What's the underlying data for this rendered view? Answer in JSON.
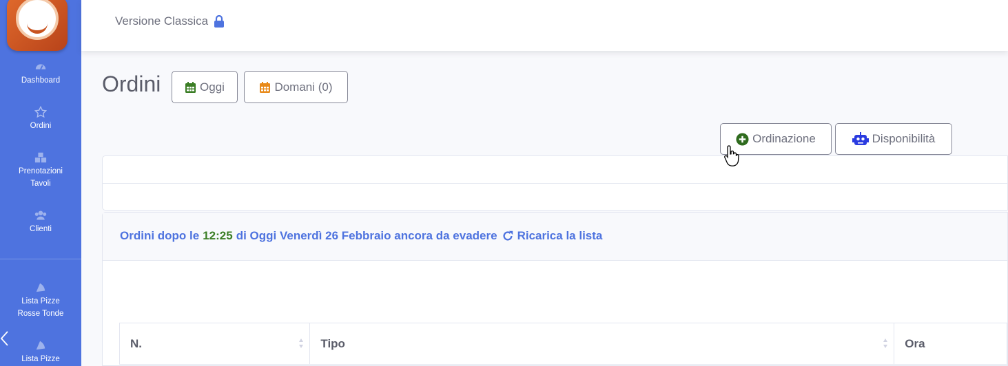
{
  "sidebar": {
    "items": [
      {
        "label": "Dashboard",
        "icon": "tachometer-icon"
      },
      {
        "label": "Ordini",
        "icon": "star-icon"
      },
      {
        "label": "Prenotazioni\nTavoli",
        "label_line1": "Prenotazioni",
        "label_line2": "Tavoli",
        "icon": "boxes-icon"
      },
      {
        "label": "Clienti",
        "icon": "users-icon"
      },
      {
        "label_line1": "Lista Pizze",
        "label_line2": "Rosse Tonde",
        "icon": "pizza-icon"
      },
      {
        "label_line1": "Lista Pizze",
        "icon": "pizza-icon"
      }
    ]
  },
  "topbar": {
    "version_label": "Versione Classica",
    "icon": "lock-icon"
  },
  "page": {
    "title": "Ordini",
    "btn_oggi": "Oggi",
    "btn_domani": "Domani (0)",
    "btn_ordinazione": "Ordinazione",
    "btn_disponibilita": "Disponibilità"
  },
  "notice": {
    "prefix": "Ordini dopo le",
    "time": "12:25",
    "suffix": "di Oggi Venerdì 26 Febbraio ancora da evadere",
    "reload": "Ricarica la lista"
  },
  "table": {
    "headers": [
      "N.",
      "Tipo",
      "Ora"
    ]
  },
  "colors": {
    "sidebar": "#4e73df",
    "accent_green": "#3a7d24",
    "accent_orange": "#e88a1a",
    "link_blue": "#4e73df"
  }
}
